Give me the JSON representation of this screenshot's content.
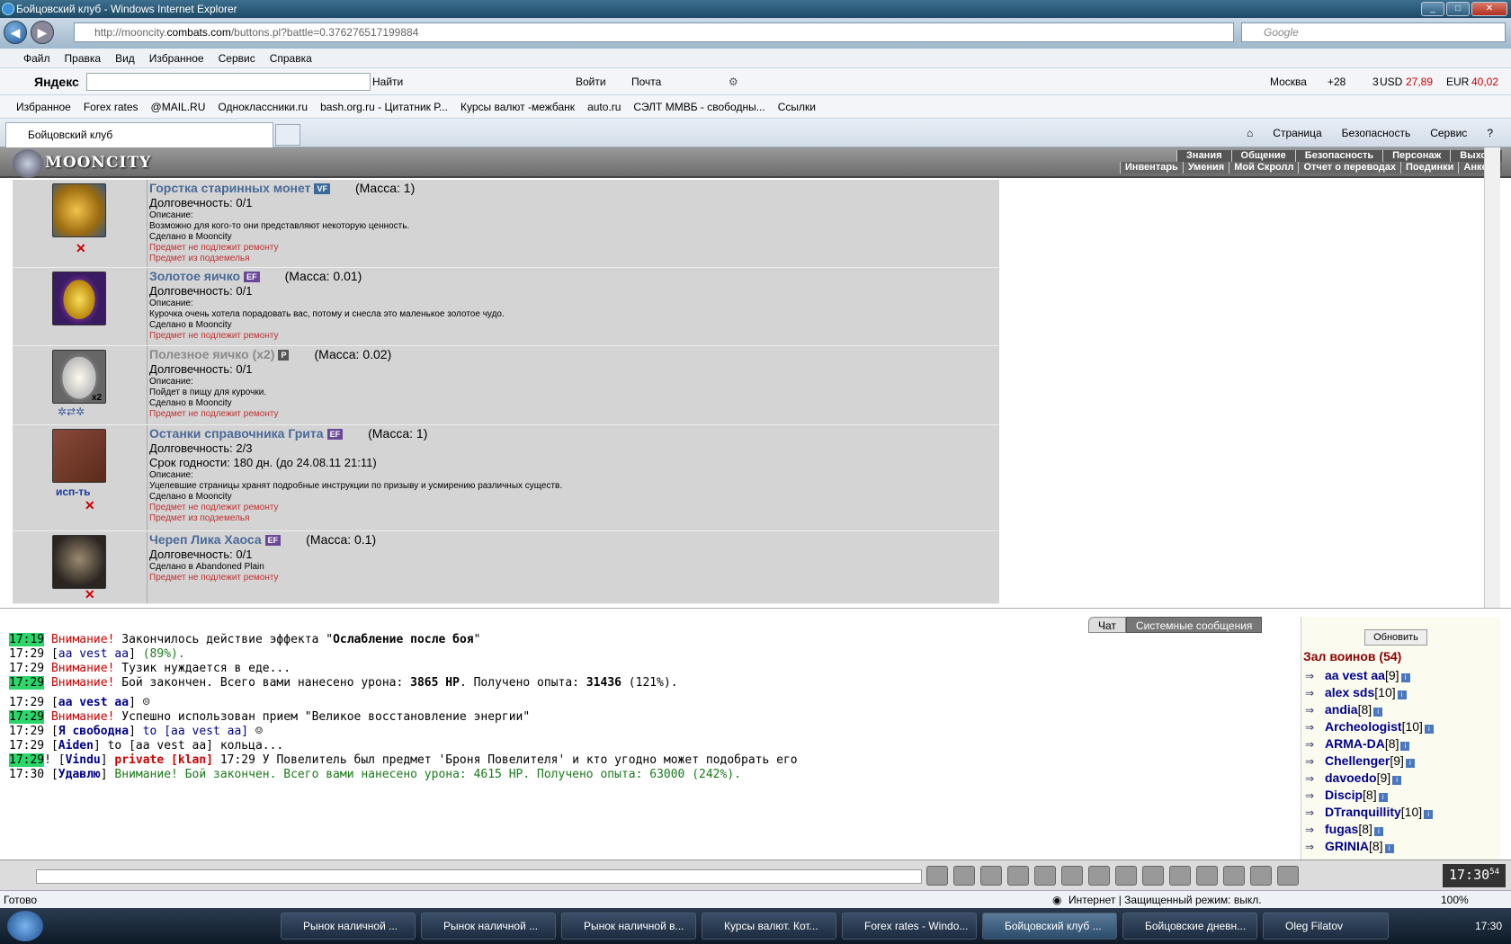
{
  "window": {
    "title": "Бойцовский клуб - Windows Internet Explorer"
  },
  "address": {
    "url_prefix": "http://mooncity.",
    "url_domain": "combats.com",
    "url_path": "/buttons.pl?battle=0.376276517199884",
    "search_placeholder": "Google"
  },
  "menu": [
    "Файл",
    "Правка",
    "Вид",
    "Избранное",
    "Сервис",
    "Справка"
  ],
  "yandex": {
    "logo": "Яндекс",
    "find": "Найти",
    "login": "Войти",
    "mail": "Почта",
    "city": "Москва",
    "temp": "+28",
    "traffic": "3",
    "usd_label": "USD",
    "usd": "27,89",
    "eur_label": "EUR",
    "eur": "40,02"
  },
  "favorites": [
    "Избранное",
    "Forex rates",
    "@MAIL.RU",
    "Одноклассники.ru",
    "bash.org.ru - Цитатник Р...",
    "Курсы валют -межбанк",
    "auto.ru",
    "СЭЛТ ММВБ - свободны...",
    "Ссылки"
  ],
  "tab": {
    "label": "Бойцовский клуб"
  },
  "commands": [
    "Страница",
    "Безопасность",
    "Сервис"
  ],
  "game": {
    "logo": "MOONCITY",
    "menu_row1": [
      "Знания",
      "Общение",
      "Безопасность",
      "Персонаж",
      "Выход"
    ],
    "menu_row2": [
      "Инвентарь",
      "Умения",
      "Мой Скролл",
      "Отчет о переводах",
      "Поединки",
      "Анкета"
    ]
  },
  "items": [
    {
      "name": "Горстка старинных монет",
      "badge": "VF",
      "mass": "(Масса: 1)",
      "dur": "Долговечность: 0/1",
      "extra": "",
      "desc_label": "Описание:",
      "desc": "Возможно для кого-то они представляют некоторую ценность.",
      "made": "Сделано в Mooncity",
      "norepair": "Предмет не подлежит ремонту",
      "dungeon": "Предмет из подземелья"
    },
    {
      "name": "Золотое яичко",
      "badge": "EF",
      "mass": "(Масса: 0.01)",
      "dur": "Долговечность: 0/1",
      "extra": "",
      "desc_label": "Описание:",
      "desc": "Курочка очень хотела порадовать вас, потому и снесла это маленькое золотое чудо.",
      "made": "Сделано в Mooncity",
      "norepair": "Предмет не подлежит ремонту",
      "dungeon": ""
    },
    {
      "name": "Полезное яичко (x2)",
      "badge": "P",
      "mass": "(Масса: 0.02)",
      "dur": "Долговечность: 0/1",
      "extra": "",
      "desc_label": "Описание:",
      "desc": "Пойдет в пищу для курочки.",
      "made": "Сделано в Mooncity",
      "norepair": "Предмет не подлежит ремонту",
      "dungeon": "",
      "count": "x2"
    },
    {
      "name": "Останки справочника Грита",
      "badge": "EF",
      "mass": "(Масса: 1)",
      "dur": "Долговечность: 2/3",
      "extra": "Срок годности: 180 дн. (до 24.08.11 21:11)",
      "desc_label": "Описание:",
      "desc": "Уцелевшие страницы хранят подробные инструкции по призыву и усмирению различных существ.",
      "made": "Сделано в Mooncity",
      "norepair": "Предмет не подлежит ремонту",
      "dungeon": "Предмет из подземелья",
      "use": "исп-ть"
    },
    {
      "name": "Череп Лика Хаоса",
      "badge": "EF",
      "mass": "(Масса: 0.1)",
      "dur": "Долговечность: 0/1",
      "extra": "",
      "desc_label": "",
      "desc": "",
      "made": "Сделано в Abandoned Plain",
      "norepair": "Предмет не подлежит ремонту",
      "dungeon": ""
    }
  ],
  "chat": {
    "tab_chat": "Чат",
    "tab_system": "Системные сообщения"
  },
  "log": [
    {
      "t": "17:19",
      "a": "Внимание!",
      "b": " Закончилось действие эффекта \"",
      "c": "Ослабление после боя",
      "d": "\""
    },
    {
      "t": "17:29",
      "n": "aa vest aa",
      "r": " (89%)."
    },
    {
      "t": "17:29",
      "a": "Внимание!",
      "r": " Тузик нуждается в еде..."
    },
    {
      "t": "17:29",
      "a": "Внимание!",
      "r": " Бой закончен. Всего вами нанесено урона: ",
      "b1": "3865 HP",
      "r2": ". Получено опыта: ",
      "b2": "31436",
      "r3": " (121%)."
    },
    {
      "t": "17:29",
      "n": "aa vest aa"
    },
    {
      "t": "17:29",
      "a": "Внимание!",
      "r": " Успешно использован прием \"Великое восстановление энергии\""
    },
    {
      "t": "17:29",
      "n": "Я свободна",
      "r": " to [aa vest aa]"
    },
    {
      "t": "17:29",
      "n": "Aiden",
      "r": " to [aa vest aa] кольца..."
    },
    {
      "t": "17:29",
      "n": "Vindu",
      "p": " private [klan]",
      "r": " 17:29 У Повелитель был предмет 'Броня Повелителя' и кто угодно может подобрать его"
    },
    {
      "t": "17:30",
      "n": "Удавлю",
      "r": " Внимание! Бой закончен. Всего вами нанесено урона: 4615 HP. Получено опыта: 63000 (242%)."
    }
  ],
  "users": {
    "refresh": "Обновить",
    "hall": "Зал воинов (54)",
    "list": [
      {
        "nm": "aa vest aa",
        "lv": "[9]"
      },
      {
        "nm": "alex sds",
        "lv": "[10]"
      },
      {
        "nm": "andia",
        "lv": "[8]"
      },
      {
        "nm": "Archeologist",
        "lv": "[10]"
      },
      {
        "nm": "ARMA-DA",
        "lv": "[8]"
      },
      {
        "nm": "Chellenger",
        "lv": "[9]"
      },
      {
        "nm": "davoedo",
        "lv": "[9]"
      },
      {
        "nm": "Discip",
        "lv": "[8]"
      },
      {
        "nm": "DTranquillity",
        "lv": "[10]"
      },
      {
        "nm": "fugas",
        "lv": "[8]"
      },
      {
        "nm": "GRINIA",
        "lv": "[8]"
      }
    ]
  },
  "clock": {
    "time": "17:30",
    "sec": "54"
  },
  "status": {
    "text": "Готово",
    "zone": "Интернет | Защищенный режим: выкл.",
    "zoom": "100%"
  },
  "taskbar": {
    "items": [
      "Рынок наличной ...",
      "Рынок наличной ...",
      "Рынок наличной в...",
      "Курсы валют. Кот...",
      "Forex rates - Windo...",
      "Бойцовский клуб ...",
      "Бойцовские дневн...",
      "Oleg Filatov"
    ],
    "time": "17:30"
  }
}
